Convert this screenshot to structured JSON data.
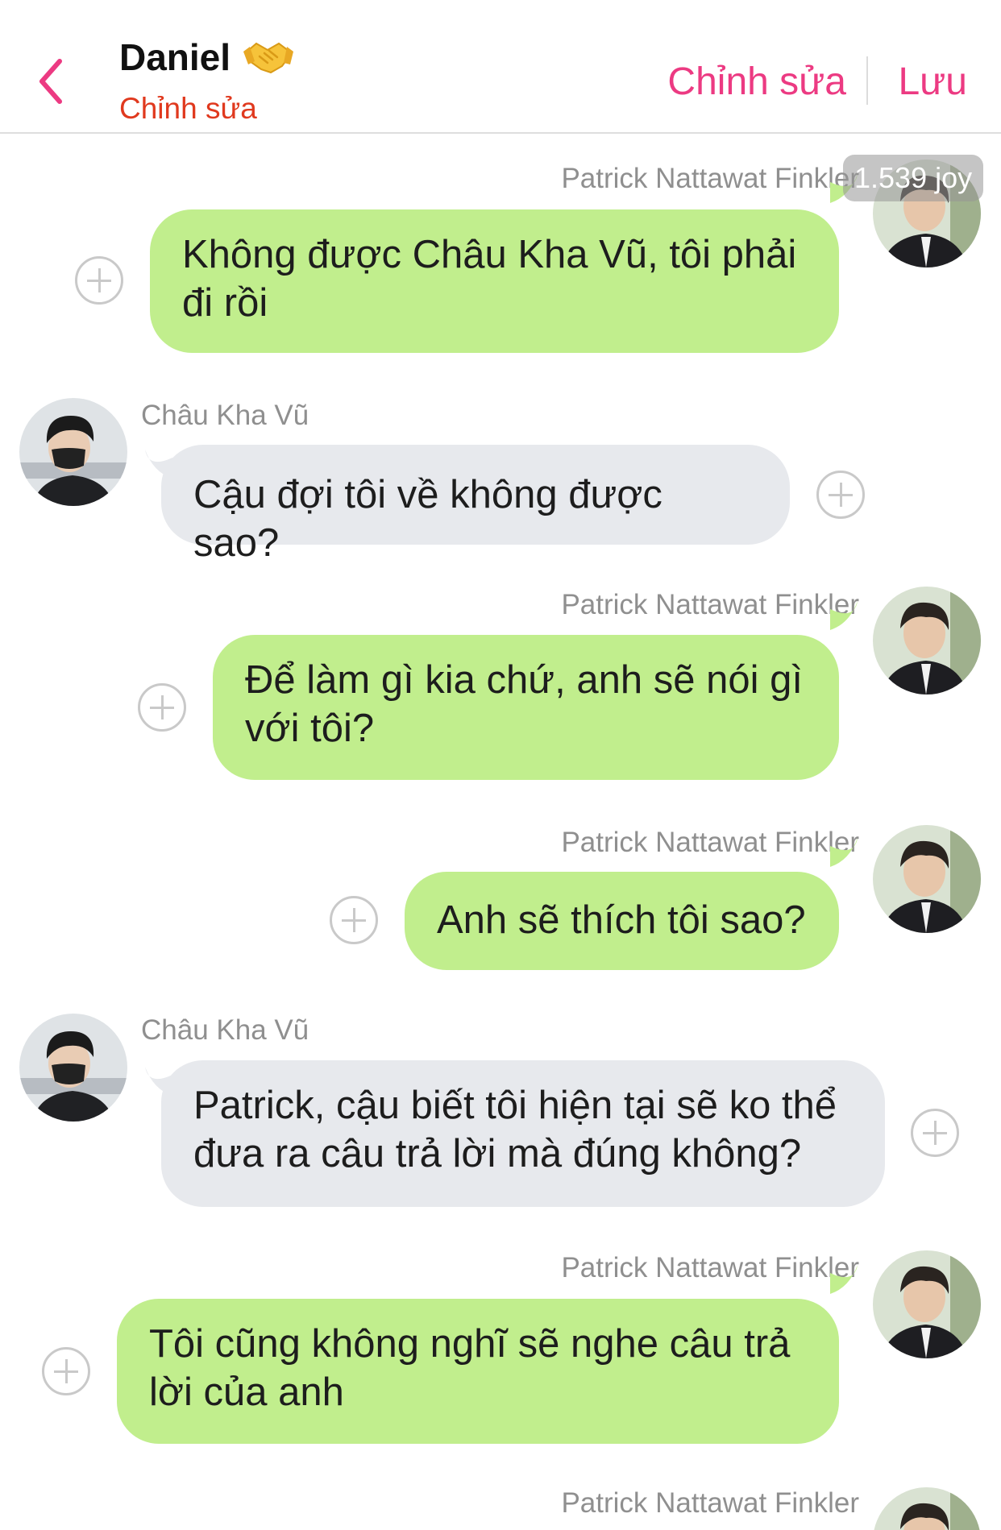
{
  "header": {
    "title": "Daniel",
    "subtitle": "Chỉnh sửa",
    "edit_label": "Chỉnh sửa",
    "save_label": "Lưu",
    "accent_color": "#ec3a82",
    "subtitle_color": "#e0391e"
  },
  "badge": {
    "joy": "1.539 joy"
  },
  "messages": [
    {
      "sender": "Patrick Nattawat Finkler",
      "side": "right",
      "text": "Không được Châu Kha Vũ, tôi phải đi rồi"
    },
    {
      "sender": "Châu Kha Vũ",
      "side": "left",
      "text": "Cậu đợi tôi về không được sao?"
    },
    {
      "sender": "Patrick Nattawat Finkler",
      "side": "right",
      "text": "Để làm gì kia chứ, anh sẽ nói gì với tôi?"
    },
    {
      "sender": "Patrick Nattawat Finkler",
      "side": "right",
      "text": "Anh sẽ thích tôi sao?"
    },
    {
      "sender": "Châu Kha Vũ",
      "side": "left",
      "text": "Patrick, cậu biết tôi hiện tại sẽ ko thể đưa ra câu trả lời mà đúng không?"
    },
    {
      "sender": "Patrick Nattawat Finkler",
      "side": "right",
      "text": "Tôi cũng không nghĩ sẽ nghe câu trả lời của anh"
    },
    {
      "sender": "Patrick Nattawat Finkler",
      "side": "right",
      "text": ""
    }
  ],
  "colors": {
    "outgoing_bubble": "#c1ee8d",
    "incoming_bubble": "#e7e9ed",
    "sender_name": "#8f8f8f"
  }
}
